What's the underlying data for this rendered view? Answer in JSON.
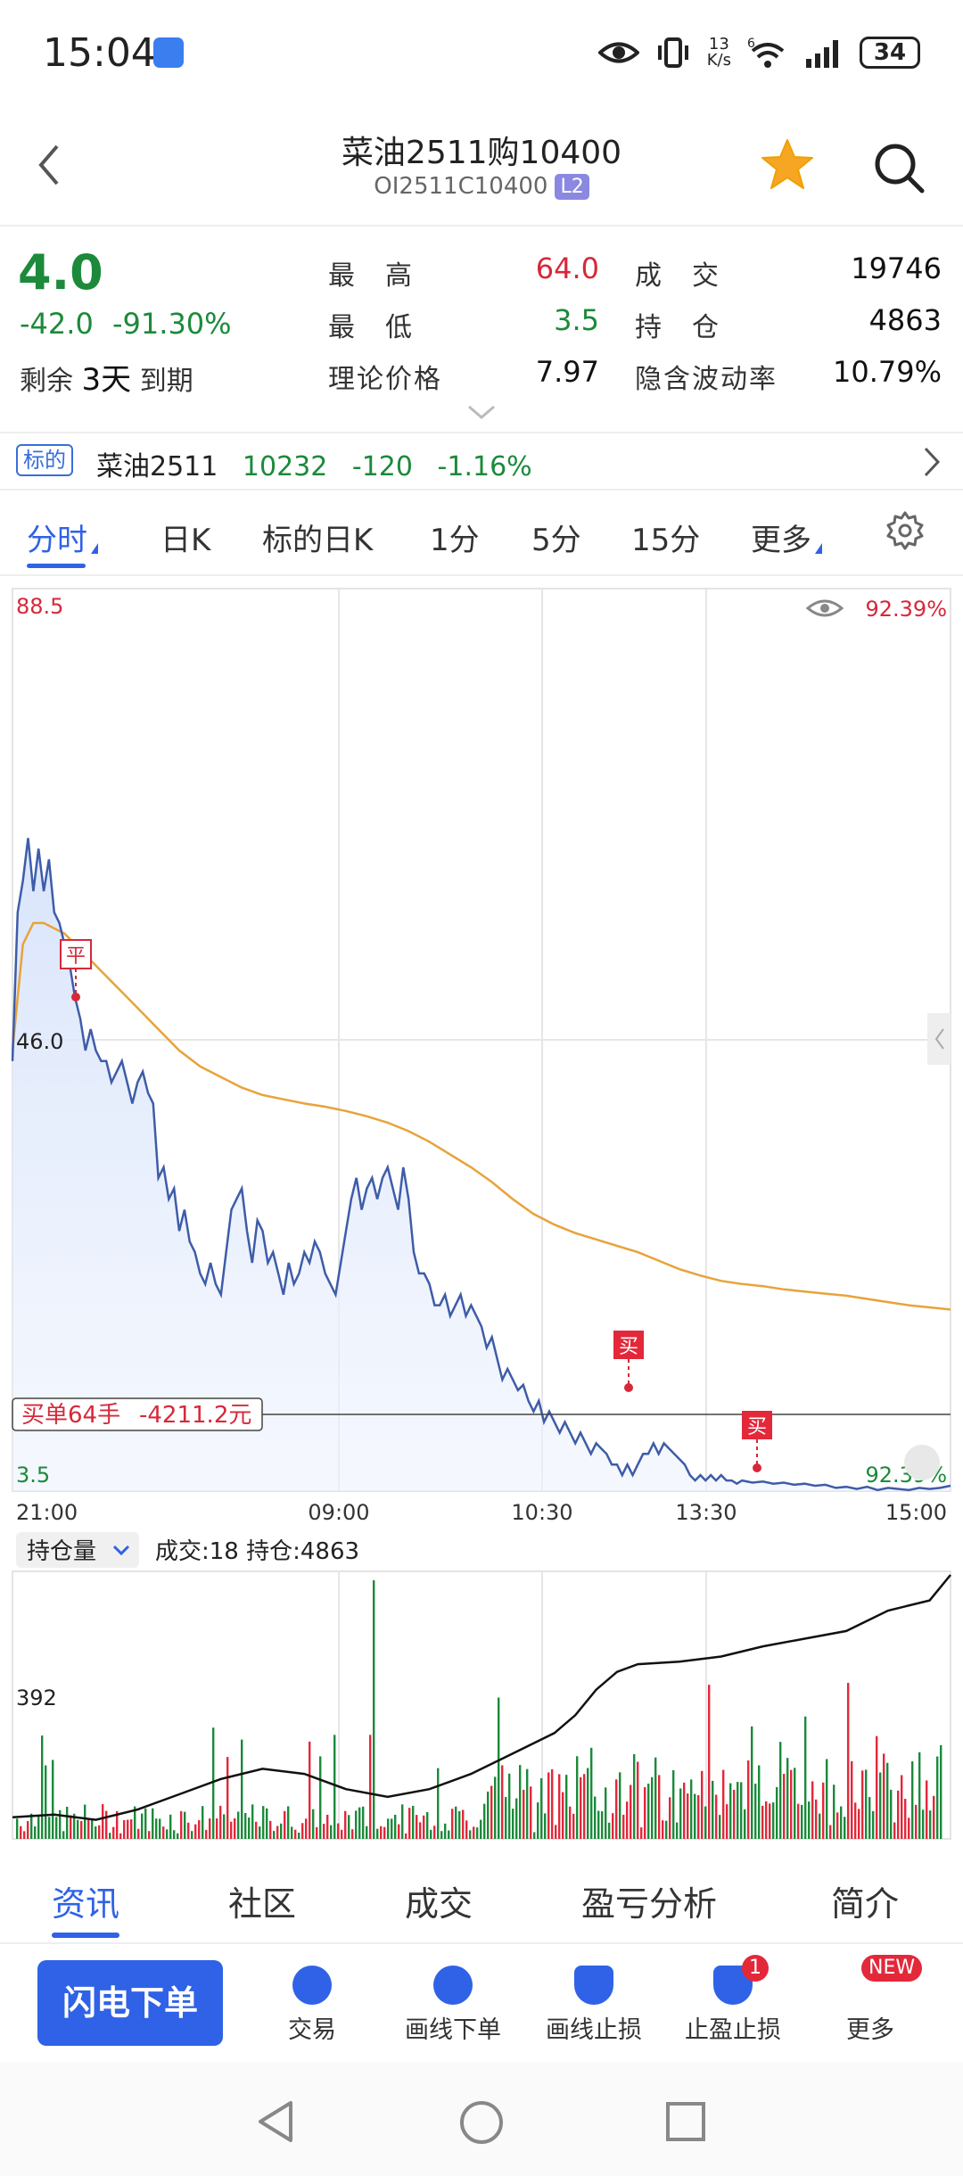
{
  "status_bar": {
    "time": "15:04",
    "net_speed_top": "13",
    "net_speed_bottom": "K/s",
    "wifi_extra": "6",
    "battery": "34"
  },
  "header": {
    "title": "菜油2511购10400",
    "code": "OI2511C10400",
    "level_badge": "L2"
  },
  "quote": {
    "price": "4.0",
    "change": "-42.0",
    "change_pct": "-91.30%",
    "remaining_prefix": "剩余",
    "remaining_days": "3天",
    "remaining_suffix": "到期",
    "high_label": "最　高",
    "high": "64.0",
    "low_label": "最　低",
    "low": "3.5",
    "theo_label": "理论价格",
    "theo": "7.97",
    "volume_label": "成　交",
    "volume": "19746",
    "oi_label": "持　仓",
    "oi": "4863",
    "iv_label": "隐含波动率",
    "iv": "10.79%"
  },
  "underlying": {
    "tag": "标的",
    "name": "菜油2511",
    "price": "10232",
    "change": "-120",
    "change_pct": "-1.16%"
  },
  "period_tabs": [
    "分时",
    "日K",
    "标的日K",
    "1分",
    "5分",
    "15分",
    "更多"
  ],
  "chart": {
    "y_max_label": "88.5",
    "y_mid_label": "46.0",
    "y_min_label": "3.5",
    "iv_top": "92.39%",
    "iv_bottom": "92.39%",
    "x_labels": [
      "21:00",
      "09:00",
      "10:30",
      "13:30",
      "15:00"
    ],
    "order_label": "买单64手",
    "order_pnl": "-4211.2元",
    "marker_close": "平",
    "marker_buy": "买",
    "vol_selector": "持仓量",
    "vol_info": "成交:18 持仓:4863",
    "vol_axis": "392"
  },
  "chart_data": {
    "type": "line",
    "y_range": [
      3.5,
      88.5
    ],
    "price_series": [
      [
        0,
        44
      ],
      [
        0.5,
        58
      ],
      [
        1,
        61
      ],
      [
        1.5,
        65
      ],
      [
        2,
        60
      ],
      [
        2.5,
        64
      ],
      [
        3,
        60
      ],
      [
        3.5,
        63
      ],
      [
        4,
        58
      ],
      [
        4.5,
        57
      ],
      [
        5,
        55
      ],
      [
        5.5,
        53
      ],
      [
        6,
        50
      ],
      [
        6.5,
        48
      ],
      [
        7,
        45
      ],
      [
        7.5,
        47
      ],
      [
        8,
        45
      ],
      [
        8.5,
        44
      ],
      [
        9,
        44
      ],
      [
        9.5,
        42
      ],
      [
        10,
        43
      ],
      [
        10.5,
        44
      ],
      [
        11,
        42
      ],
      [
        11.5,
        40
      ],
      [
        12,
        42
      ],
      [
        12.5,
        43
      ],
      [
        13,
        41
      ],
      [
        13.5,
        40
      ],
      [
        14,
        33
      ],
      [
        14.5,
        34
      ],
      [
        15,
        31
      ],
      [
        15.5,
        32
      ],
      [
        16,
        28
      ],
      [
        16.5,
        30
      ],
      [
        17,
        27
      ],
      [
        17.5,
        26
      ],
      [
        18,
        24
      ],
      [
        18.5,
        23
      ],
      [
        19,
        25
      ],
      [
        19.5,
        23
      ],
      [
        20,
        22
      ],
      [
        20.5,
        26
      ],
      [
        21,
        30
      ],
      [
        21.5,
        31
      ],
      [
        22,
        32
      ],
      [
        22.5,
        28
      ],
      [
        23,
        25
      ],
      [
        23.5,
        29
      ],
      [
        24,
        28
      ],
      [
        24.5,
        25
      ],
      [
        25,
        26
      ],
      [
        25.5,
        24
      ],
      [
        26,
        22
      ],
      [
        26.5,
        25
      ],
      [
        27,
        23
      ],
      [
        27.5,
        24
      ],
      [
        28,
        26
      ],
      [
        28.5,
        25
      ],
      [
        29,
        27
      ],
      [
        29.5,
        26
      ],
      [
        30,
        24
      ],
      [
        30.5,
        23
      ],
      [
        31,
        22
      ],
      [
        31.5,
        25
      ],
      [
        32,
        28
      ],
      [
        32.5,
        31
      ],
      [
        33,
        33
      ],
      [
        33.5,
        30
      ],
      [
        34,
        32
      ],
      [
        34.5,
        33
      ],
      [
        35,
        31
      ],
      [
        35.5,
        33
      ],
      [
        36,
        34
      ],
      [
        36.5,
        32
      ],
      [
        37,
        30
      ],
      [
        37.5,
        34
      ],
      [
        38,
        31
      ],
      [
        38.5,
        26
      ],
      [
        39,
        24
      ],
      [
        39.5,
        24
      ],
      [
        40,
        23
      ],
      [
        40.5,
        21
      ],
      [
        41,
        21
      ],
      [
        41.5,
        22
      ],
      [
        42,
        20
      ],
      [
        42.5,
        21
      ],
      [
        43,
        22
      ],
      [
        43.5,
        20
      ],
      [
        44,
        21
      ],
      [
        44.5,
        20
      ],
      [
        45,
        19
      ],
      [
        45.5,
        17
      ],
      [
        46,
        18
      ],
      [
        46.5,
        16
      ],
      [
        47,
        14
      ],
      [
        47.5,
        15
      ],
      [
        48,
        14
      ],
      [
        48.5,
        13
      ],
      [
        49,
        13.5
      ],
      [
        49.5,
        12
      ],
      [
        50,
        11
      ],
      [
        50.5,
        12
      ],
      [
        51,
        10
      ],
      [
        51.5,
        11
      ],
      [
        52,
        10
      ],
      [
        52.5,
        9
      ],
      [
        53,
        10
      ],
      [
        53.5,
        9
      ],
      [
        54,
        8
      ],
      [
        54.5,
        9
      ],
      [
        55,
        8
      ],
      [
        55.5,
        7
      ],
      [
        56,
        8
      ],
      [
        56.5,
        7.5
      ],
      [
        57,
        7
      ],
      [
        57.5,
        6
      ],
      [
        58,
        6
      ],
      [
        58.5,
        5
      ],
      [
        59,
        6
      ],
      [
        59.5,
        5
      ],
      [
        60,
        6
      ],
      [
        60.5,
        7
      ],
      [
        61,
        7
      ],
      [
        61.5,
        8
      ],
      [
        62,
        7
      ],
      [
        62.5,
        8
      ],
      [
        63,
        7.5
      ],
      [
        63.5,
        7
      ],
      [
        64,
        6.5
      ],
      [
        64.5,
        6
      ],
      [
        65,
        5
      ],
      [
        65.5,
        4.5
      ],
      [
        66,
        5
      ],
      [
        66.5,
        4.5
      ],
      [
        67,
        5
      ],
      [
        67.5,
        4.5
      ],
      [
        68,
        5
      ],
      [
        68.5,
        4.5
      ],
      [
        69,
        4.5
      ],
      [
        69.5,
        4.2
      ],
      [
        70,
        4.5
      ],
      [
        71,
        4.3
      ],
      [
        72,
        4.4
      ],
      [
        73,
        4.2
      ],
      [
        74,
        4.3
      ],
      [
        75,
        4.1
      ],
      [
        76,
        4.2
      ],
      [
        77,
        4
      ],
      [
        78,
        4.1
      ],
      [
        79,
        3.8
      ],
      [
        80,
        3.9
      ],
      [
        81,
        3.7
      ],
      [
        82,
        3.9
      ],
      [
        83,
        3.6
      ],
      [
        84,
        3.8
      ],
      [
        85,
        3.7
      ],
      [
        86,
        3.6
      ],
      [
        87,
        3.8
      ],
      [
        88,
        3.7
      ],
      [
        89,
        3.8
      ],
      [
        90,
        4.0
      ]
    ],
    "avg_series": [
      [
        0,
        45
      ],
      [
        1,
        55
      ],
      [
        2,
        57
      ],
      [
        3,
        57
      ],
      [
        4,
        56.5
      ],
      [
        5,
        56
      ],
      [
        6,
        55
      ],
      [
        7,
        54
      ],
      [
        8,
        53
      ],
      [
        9,
        52
      ],
      [
        10,
        51
      ],
      [
        12,
        49
      ],
      [
        14,
        47
      ],
      [
        16,
        45
      ],
      [
        18,
        43.5
      ],
      [
        20,
        42.5
      ],
      [
        22,
        41.5
      ],
      [
        24,
        40.8
      ],
      [
        26,
        40.4
      ],
      [
        28,
        40
      ],
      [
        30,
        39.7
      ],
      [
        32,
        39.3
      ],
      [
        34,
        38.8
      ],
      [
        36,
        38.2
      ],
      [
        38,
        37.4
      ],
      [
        40,
        36.4
      ],
      [
        42,
        35.2
      ],
      [
        44,
        34
      ],
      [
        46,
        32.6
      ],
      [
        48,
        31
      ],
      [
        50,
        29.6
      ],
      [
        52,
        28.6
      ],
      [
        54,
        27.8
      ],
      [
        56,
        27.2
      ],
      [
        58,
        26.6
      ],
      [
        60,
        26
      ],
      [
        62,
        25.2
      ],
      [
        64,
        24.4
      ],
      [
        66,
        23.8
      ],
      [
        68,
        23.3
      ],
      [
        70,
        23
      ],
      [
        72,
        22.8
      ],
      [
        74,
        22.5
      ],
      [
        76,
        22.3
      ],
      [
        78,
        22.1
      ],
      [
        80,
        21.9
      ],
      [
        82,
        21.6
      ],
      [
        84,
        21.3
      ],
      [
        86,
        21
      ],
      [
        88,
        20.8
      ],
      [
        90,
        20.6
      ]
    ],
    "open_interest": [
      [
        0,
        0.05
      ],
      [
        4,
        0.06
      ],
      [
        8,
        0.04
      ],
      [
        12,
        0.08
      ],
      [
        16,
        0.14
      ],
      [
        20,
        0.2
      ],
      [
        24,
        0.24
      ],
      [
        28,
        0.22
      ],
      [
        32,
        0.16
      ],
      [
        36,
        0.13
      ],
      [
        40,
        0.16
      ],
      [
        44,
        0.22
      ],
      [
        48,
        0.3
      ],
      [
        52,
        0.38
      ],
      [
        54,
        0.45
      ],
      [
        56,
        0.55
      ],
      [
        58,
        0.62
      ],
      [
        60,
        0.65
      ],
      [
        64,
        0.66
      ],
      [
        68,
        0.68
      ],
      [
        72,
        0.72
      ],
      [
        76,
        0.75
      ],
      [
        80,
        0.78
      ],
      [
        84,
        0.86
      ],
      [
        88,
        0.9
      ],
      [
        90,
        1.0
      ]
    ]
  },
  "bottom_tabs": [
    "资讯",
    "社区",
    "成交",
    "盈亏分析",
    "简介"
  ],
  "actions": {
    "flash_order": "闪电下单",
    "items": [
      "交易",
      "画线下单",
      "画线止损",
      "止盈止损",
      "更多"
    ],
    "stop_badge": "1",
    "more_badge": "NEW"
  }
}
